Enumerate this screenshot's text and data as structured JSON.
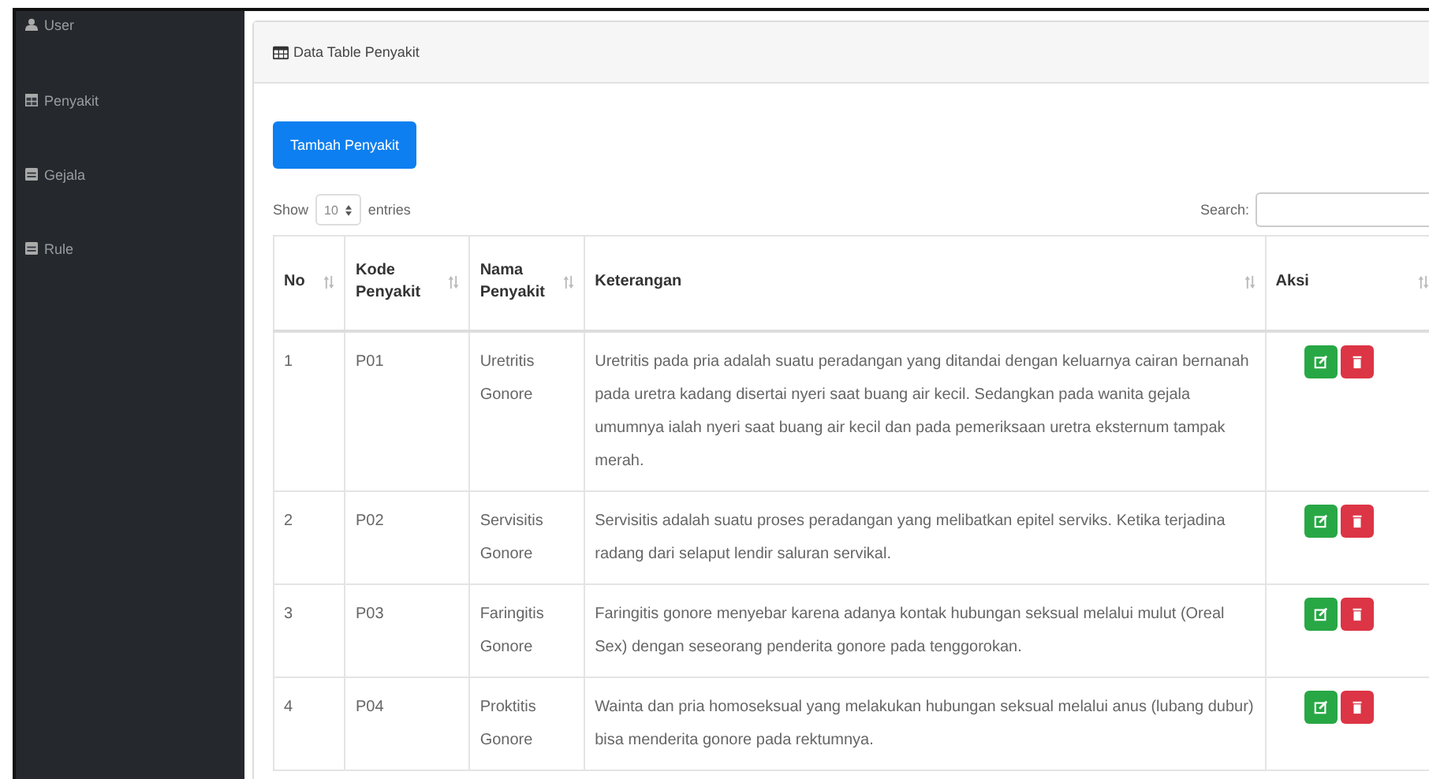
{
  "sidebar": {
    "items": [
      {
        "label": "User"
      },
      {
        "label": "Penyakit"
      },
      {
        "label": "Gejala"
      },
      {
        "label": "Rule"
      }
    ]
  },
  "card": {
    "title": "Data Table Penyakit"
  },
  "add_button": "Tambah Penyakit",
  "length_control": {
    "show_label": "Show",
    "value": "10",
    "entries_label": "entries"
  },
  "search": {
    "label": "Search:"
  },
  "table": {
    "columns": [
      {
        "label": "No"
      },
      {
        "label": "Kode Penyakit"
      },
      {
        "label": "Nama Penyakit"
      },
      {
        "label": "Keterangan"
      },
      {
        "label": "Aksi"
      }
    ],
    "rows": [
      {
        "no": "1",
        "kode": "P01",
        "nama": "Uretritis Gonore",
        "keterangan": "Uretritis pada pria adalah suatu peradangan yang ditandai dengan keluarnya cairan bernanah pada uretra kadang disertai nyeri saat buang air kecil. Sedangkan pada wanita gejala umumnya ialah nyeri saat buang air kecil dan pada pemeriksaan uretra eksternum tampak merah."
      },
      {
        "no": "2",
        "kode": "P02",
        "nama": "Servisitis Gonore",
        "keterangan": "Servisitis adalah suatu proses peradangan yang melibatkan epitel serviks. Ketika terjadina radang dari selaput lendir saluran servikal."
      },
      {
        "no": "3",
        "kode": "P03",
        "nama": "Faringitis Gonore",
        "keterangan": "Faringitis gonore menyebar karena adanya kontak hubungan seksual melalui mulut (Oreal Sex) dengan seseorang penderita gonore pada tenggorokan."
      },
      {
        "no": "4",
        "kode": "P04",
        "nama": "Proktitis Gonore",
        "keterangan": "Wainta dan pria homoseksual yang melakukan hubungan seksual melalui anus (lubang dubur) bisa menderita gonore pada rektumnya."
      }
    ]
  }
}
